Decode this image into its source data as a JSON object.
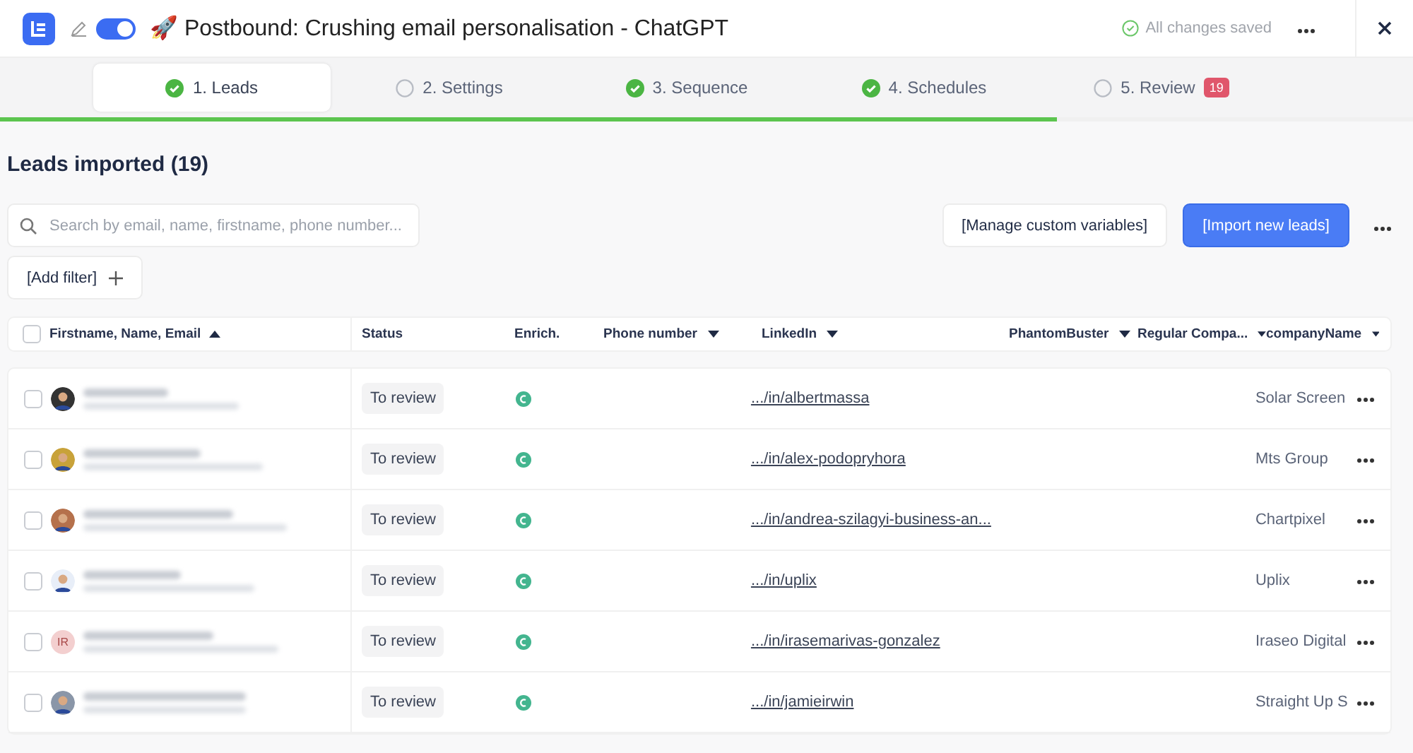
{
  "header": {
    "title_emoji": "🚀",
    "title": "Postbound: Crushing email personalisation - ChatGPT",
    "toggle_on": true,
    "save_status": "All changes saved"
  },
  "steps": [
    {
      "label": "1. Leads",
      "done": true,
      "selected": true
    },
    {
      "label": "2. Settings",
      "done": false,
      "selected": false
    },
    {
      "label": "3. Sequence",
      "done": true,
      "selected": false
    },
    {
      "label": "4. Schedules",
      "done": true,
      "selected": false
    },
    {
      "label": "5. Review",
      "done": false,
      "selected": false,
      "badge": "19"
    }
  ],
  "progress": {
    "level": 0.748
  },
  "heading": "Leads imported (19)",
  "search": {
    "placeholder": "Search by email, name, firstname, phone number..."
  },
  "buttons": {
    "manage": "[Manage custom variables]",
    "import": "[Import new leads]"
  },
  "filter_button": "[Add filter]",
  "table": {
    "all_checked": false,
    "columns": [
      {
        "label": "Firstname, Name, Email",
        "kind": "sorted"
      },
      {
        "label": "Status",
        "kind": "plain"
      },
      {
        "label": "Enrich.",
        "kind": "plain"
      },
      {
        "label": "Phone number",
        "kind": "menu"
      },
      {
        "label": "LinkedIn",
        "kind": "menu"
      },
      {
        "label": "PhantomBuster",
        "kind": "menu"
      },
      {
        "label": "Regular Compa...",
        "kind": "menu"
      },
      {
        "label": "companyName",
        "kind": "menu"
      }
    ],
    "rows": [
      {
        "checked": false,
        "status": "To review",
        "linkedin": ".../in/albertmassa",
        "company": "Solar Screen"
      },
      {
        "checked": false,
        "status": "To review",
        "linkedin": ".../in/alex-podopryhora",
        "company": "Mts Group"
      },
      {
        "checked": false,
        "status": "To review",
        "linkedin": ".../in/andrea-szilagyi-business-an...",
        "company": "Chartpixel"
      },
      {
        "checked": false,
        "status": "To review",
        "linkedin": ".../in/uplix",
        "company": "Uplix"
      },
      {
        "checked": false,
        "avatar": {
          "kind": "initials",
          "text": "IR"
        },
        "status": "To review",
        "linkedin": ".../in/irasemarivas-gonzalez",
        "company": "Iraseo Digital"
      },
      {
        "checked": false,
        "status": "To review",
        "linkedin": ".../in/jamieirwin",
        "company": "Straight Up S"
      }
    ]
  }
}
